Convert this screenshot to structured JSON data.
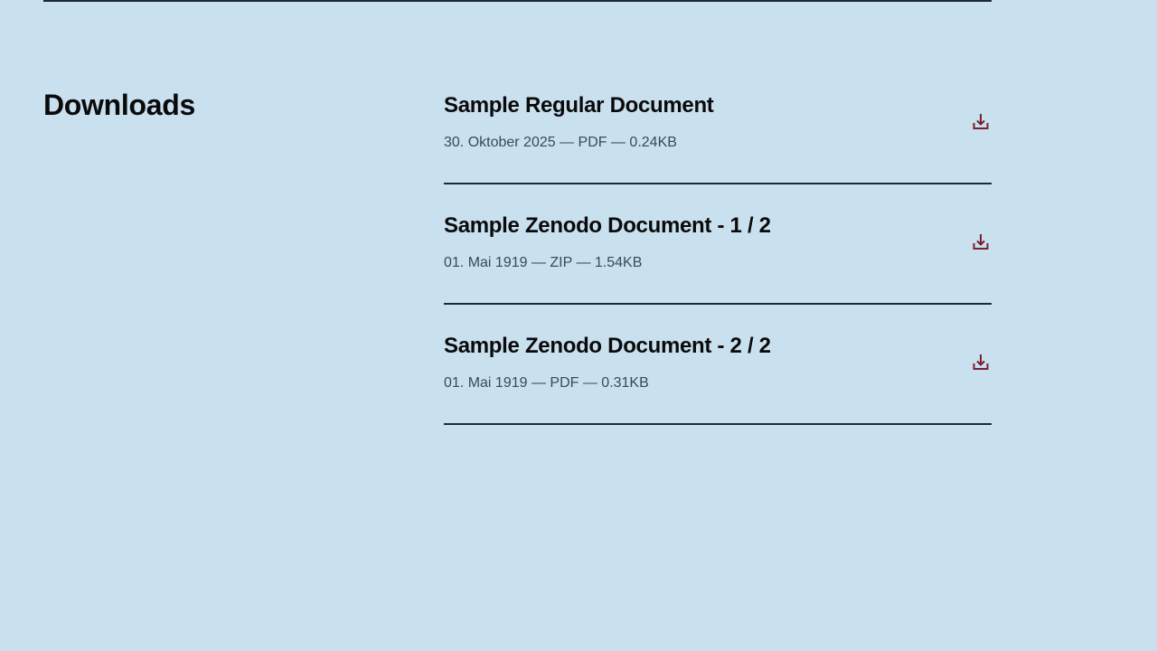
{
  "section": {
    "title": "Downloads"
  },
  "downloads": [
    {
      "title": "Sample Regular Document",
      "meta": "30. Oktober 2025 — PDF — 0.24KB",
      "icon": "download-icon"
    },
    {
      "title": "Sample Zenodo Document - 1 / 2",
      "meta": "01. Mai 1919 — ZIP — 1.54KB",
      "icon": "download-icon"
    },
    {
      "title": "Sample Zenodo Document - 2 / 2",
      "meta": "01. Mai 1919 — PDF — 0.31KB",
      "icon": "download-icon"
    }
  ],
  "colors": {
    "background": "#c9e0ef",
    "rule": "#1c2a38",
    "icon": "#7a1f2e",
    "meta_text": "#3a4a5a"
  }
}
